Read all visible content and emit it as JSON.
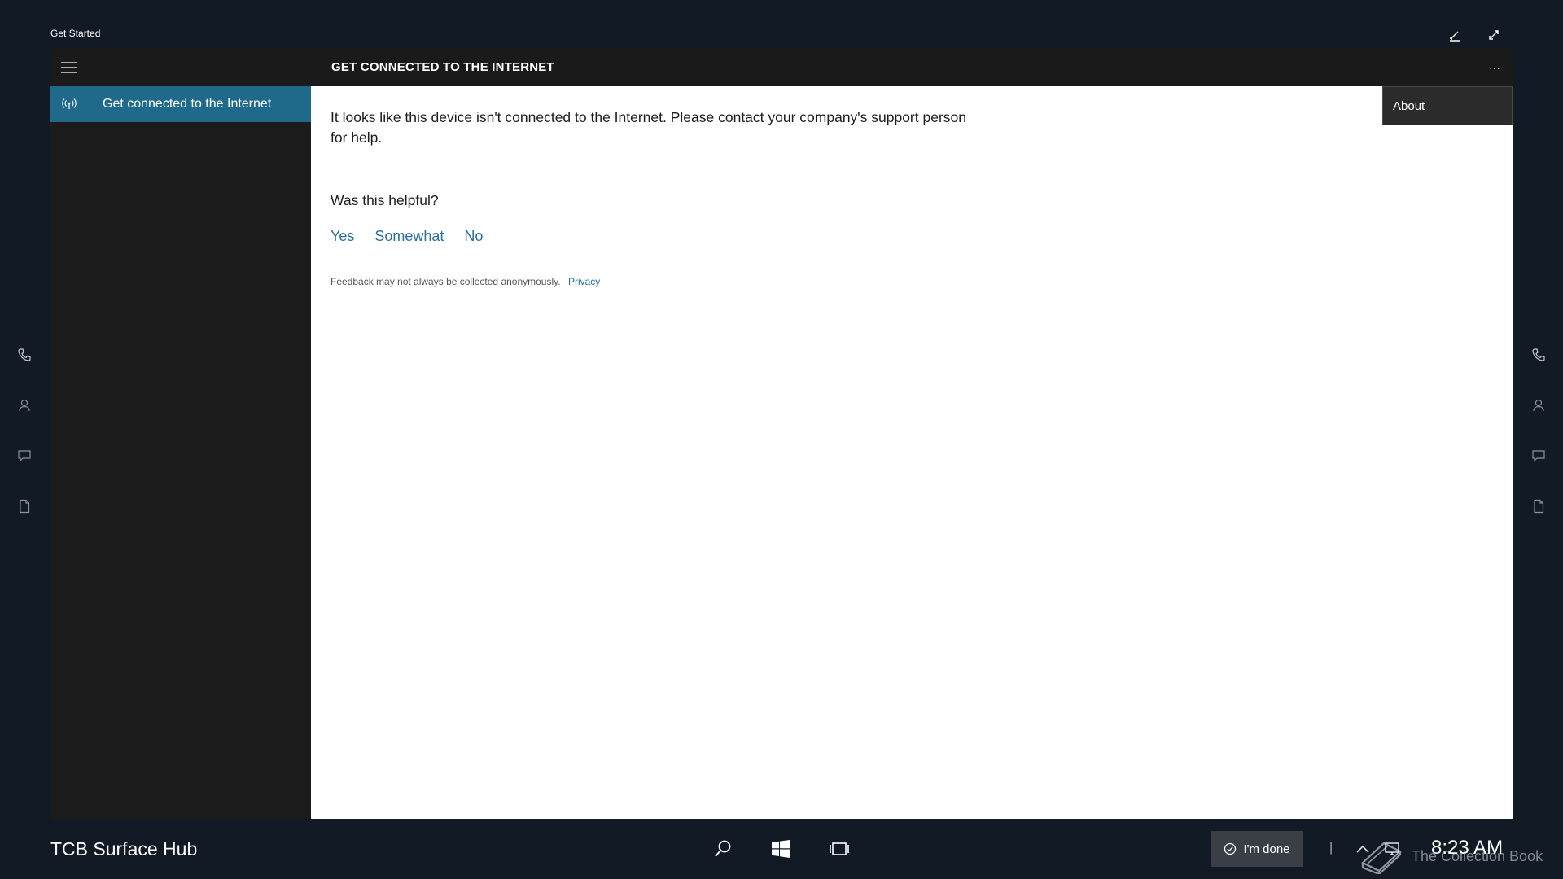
{
  "window": {
    "title": "Get Started",
    "edit_icon": "pen-icon",
    "fullscreen_icon": "expand-icon"
  },
  "app": {
    "heading": "GET CONNECTED TO THE INTERNET",
    "more_label": "···",
    "nav": {
      "items": [
        {
          "label": "Get connected to the Internet",
          "icon": "wireless-icon",
          "selected": true
        }
      ]
    },
    "content": {
      "message": "It looks like this device isn't connected to the Internet. Please contact your company's support person for help.",
      "helpful_question": "Was this helpful?",
      "feedback_options": [
        "Yes",
        "Somewhat",
        "No"
      ],
      "disclaimer": "Feedback may not always be collected anonymously.",
      "privacy_link": "Privacy"
    },
    "menu": {
      "about": "About"
    }
  },
  "side_rails": {
    "icons": [
      "phone-icon",
      "person-icon",
      "chat-icon",
      "document-icon"
    ]
  },
  "taskbar": {
    "device_name": "TCB Surface Hub",
    "done_label": "I'm done",
    "separator": "|",
    "clock": "8:23 AM",
    "watermark": "The Collection Book"
  },
  "colors": {
    "background": "#121a26",
    "accent": "#1f6a8a",
    "link": "#2b6f9e"
  }
}
